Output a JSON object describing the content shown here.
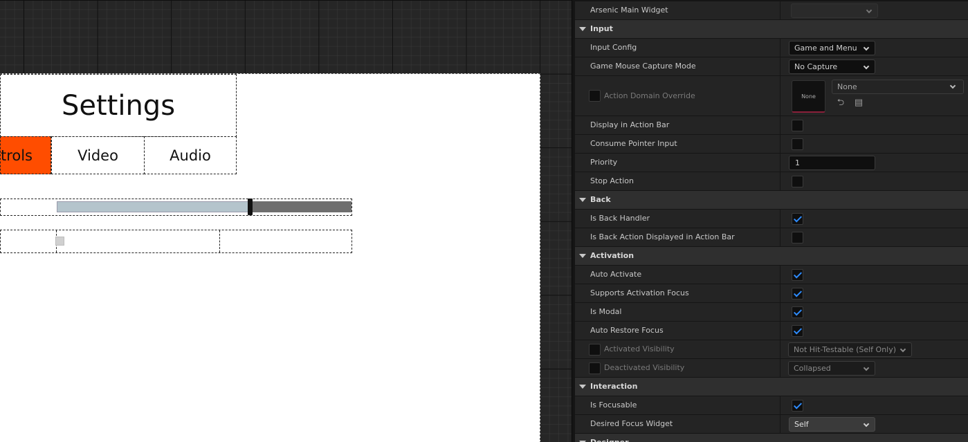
{
  "designer": {
    "title": "Settings",
    "tabs": [
      "ntrols",
      "Video",
      "Audio"
    ]
  },
  "panel": {
    "rows": {
      "arsenic_main_widget": "Arsenic Main Widget",
      "input_category": "Input",
      "input_config": {
        "label": "Input Config",
        "value": "Game and Menu"
      },
      "mouse_capture": {
        "label": "Game Mouse Capture Mode",
        "value": "No Capture"
      },
      "action_domain": {
        "label": "Action Domain Override",
        "thumb": "None",
        "value": "None"
      },
      "display_action_bar": "Display in Action Bar",
      "consume_pointer": "Consume Pointer Input",
      "priority": {
        "label": "Priority",
        "value": "1"
      },
      "stop_action": "Stop Action",
      "back_category": "Back",
      "is_back_handler": "Is Back Handler",
      "back_action_displayed": "Is Back Action Displayed in Action Bar",
      "activation_category": "Activation",
      "auto_activate": "Auto Activate",
      "supports_activation_focus": "Supports Activation Focus",
      "is_modal": "Is Modal",
      "auto_restore_focus": "Auto Restore Focus",
      "activated_visibility": {
        "label": "Activated Visibility",
        "value": "Not Hit-Testable (Self Only)"
      },
      "deactivated_visibility": {
        "label": "Deactivated Visibility",
        "value": "Collapsed"
      },
      "interaction_category": "Interaction",
      "is_focusable": "Is Focusable",
      "desired_focus": {
        "label": "Desired Focus Widget",
        "value": "Self"
      },
      "designer_category": "Designer"
    },
    "checked": {
      "display_action_bar": false,
      "consume_pointer": false,
      "stop_action": false,
      "is_back_handler": true,
      "back_action_displayed": false,
      "auto_activate": true,
      "supports_activation_focus": true,
      "is_modal": true,
      "auto_restore_focus": true,
      "is_focusable": true
    },
    "colors": {
      "accent": "#2e8cff",
      "tab_active": "#ff4d00"
    }
  }
}
